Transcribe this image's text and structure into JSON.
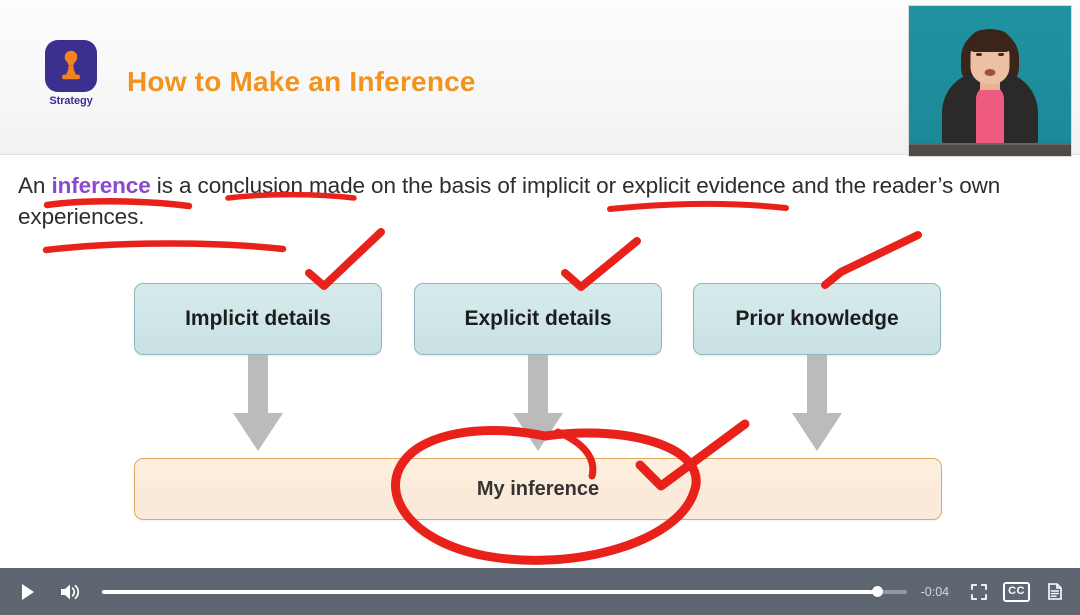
{
  "slide": {
    "badge": {
      "label": "Strategy",
      "icon": "chess-pawn-icon",
      "tile_color": "#3b2f8f",
      "pawn_color": "#f4821f"
    },
    "title": "How to Make an Inference",
    "title_color": "#f0941f",
    "paragraph": {
      "before_highlight": "An ",
      "highlight": "inference",
      "highlight_color": "#8a4ad0",
      "after_highlight": " is a conclusion made on the basis of implicit or explicit evidence and the reader’s own experiences."
    },
    "diagram": {
      "top_nodes": [
        {
          "label": "Implicit details"
        },
        {
          "label": "Explicit details"
        },
        {
          "label": "Prior knowledge"
        }
      ],
      "bottom_node": {
        "label": "My inference"
      },
      "node_fill": "#cfe6e8",
      "node_border": "#8fb6bd",
      "bottom_fill": "#fbead9",
      "bottom_border": "#e6a860",
      "arrow_color": "#bbbbbb"
    },
    "annotations": {
      "ink_color": "#e8211a",
      "marks": [
        {
          "type": "underline",
          "target": "inference"
        },
        {
          "type": "underline",
          "target": "conclusion"
        },
        {
          "type": "underline",
          "target": "implicit or explicit"
        },
        {
          "type": "underline",
          "target": "reader’s own experiences"
        },
        {
          "type": "checkmark",
          "target": "Implicit details"
        },
        {
          "type": "checkmark",
          "target": "Explicit details"
        },
        {
          "type": "checkmark",
          "target": "Prior knowledge"
        },
        {
          "type": "ellipse",
          "target": "My inference"
        },
        {
          "type": "checkmark",
          "target": "My inference"
        }
      ]
    },
    "presenter_video": {
      "background_color": "#1e8e9c",
      "description": "presenter"
    }
  },
  "controls": {
    "play_icon": "play-icon",
    "volume_icon": "volume-icon",
    "time_remaining": "-0:04",
    "progress_percent": 96,
    "fullscreen_icon": "fullscreen-icon",
    "cc_label": "CC",
    "transcript_icon": "transcript-icon",
    "bar_color": "#5d6671"
  }
}
